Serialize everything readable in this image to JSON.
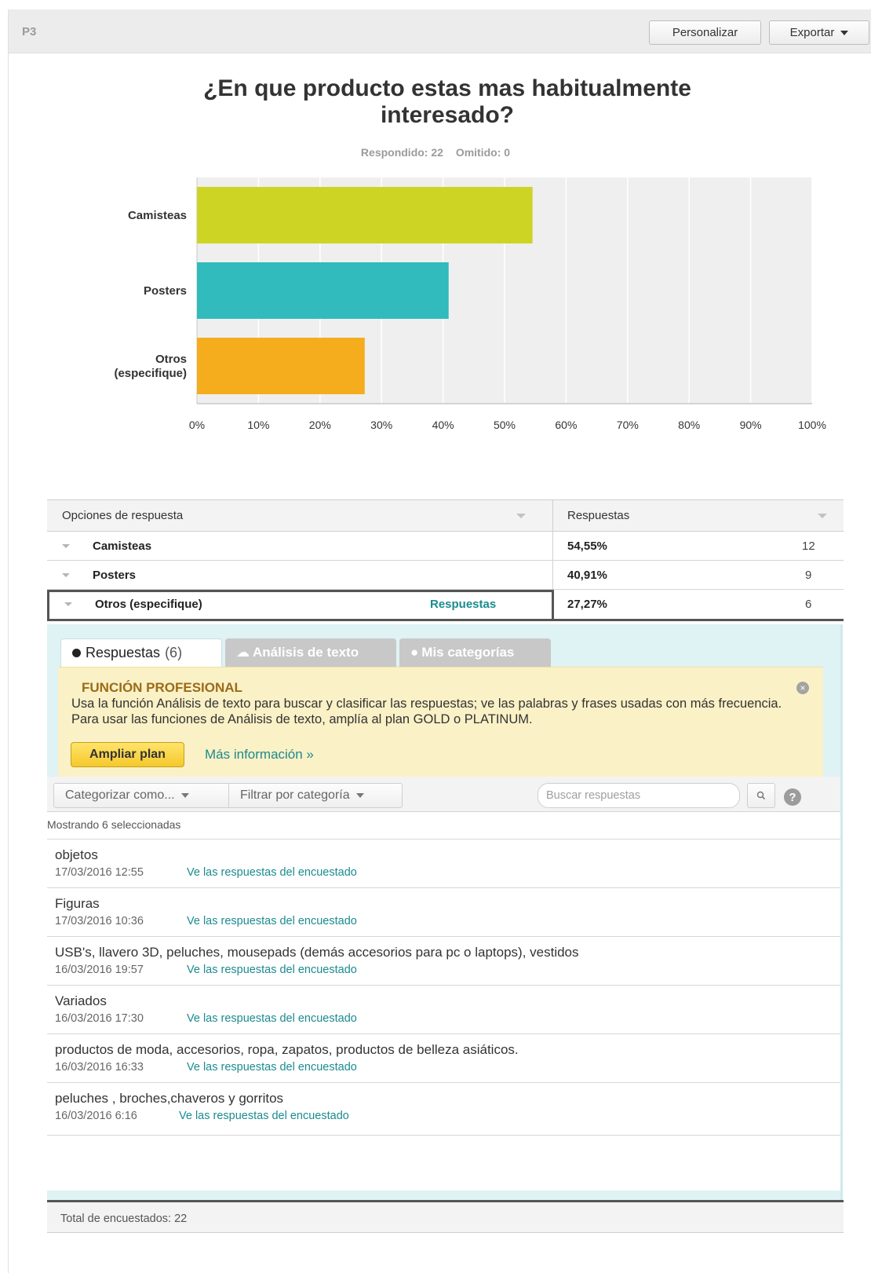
{
  "header": {
    "question_label": "P3",
    "personalize_label": "Personalizar",
    "export_label": "Exportar"
  },
  "question": {
    "title": "¿En que producto estas mas habitualmente interesado?",
    "answered": "Respondido: 22",
    "skipped": "Omitido: 0"
  },
  "colors": {
    "camisteas": "#cdd423",
    "posters": "#31bbbc",
    "otros": "#f5ad1d",
    "link": "#1b8b8e"
  },
  "chart_data": {
    "type": "bar",
    "orientation": "horizontal",
    "categories": [
      "Camisteas",
      "Posters",
      "Otros (especifique)"
    ],
    "values": [
      54.55,
      40.91,
      27.27
    ],
    "xlim": [
      0,
      100
    ],
    "x_ticks": [
      "0%",
      "10%",
      "20%",
      "30%",
      "40%",
      "50%",
      "60%",
      "70%",
      "80%",
      "90%",
      "100%"
    ],
    "grid": true
  },
  "table": {
    "col1_header": "Opciones de respuesta",
    "col2_header": "Respuestas",
    "rows": [
      {
        "label": "Camisteas",
        "pct": "54,55%",
        "count": "12"
      },
      {
        "label": "Posters",
        "pct": "40,91%",
        "count": "9"
      },
      {
        "label": "Otros (especifique)",
        "pct": "27,27%",
        "count": "6",
        "link": "Respuestas"
      }
    ],
    "total": "Total de encuestados: 22"
  },
  "tabs": {
    "responses_label": "Respuestas",
    "responses_count": "(6)",
    "text_analysis_label": "Análisis de texto",
    "categories_label": "Mis categorías"
  },
  "promo": {
    "title": "FUNCIÓN PROFESIONAL",
    "text": "Usa la función Análisis de texto para buscar y clasificar las respuestas; ve las palabras y frases usadas con más frecuencia. Para usar las funciones de Análisis de texto, amplía al plan GOLD o PLATINUM.",
    "upgrade_label": "Ampliar plan",
    "more_label": "Más información »"
  },
  "toolbar": {
    "categorize_label": "Categorizar como...",
    "filter_label": "Filtrar por categoría",
    "search_placeholder": "Buscar respuestas"
  },
  "responses": {
    "showing": "Mostrando 6 seleccionadas",
    "link_label": "Ve las respuestas del encuestado",
    "items": [
      {
        "text": "objetos",
        "date": "17/03/2016 12:55"
      },
      {
        "text": "Figuras",
        "date": "17/03/2016 10:36"
      },
      {
        "text": "USB's, llavero 3D, peluches, mousepads (demás accesorios para pc o laptops), vestidos",
        "date": "16/03/2016 19:57"
      },
      {
        "text": "Variados",
        "date": "16/03/2016 17:30"
      },
      {
        "text": "productos de moda, accesorios, ropa, zapatos, productos de belleza asiáticos.",
        "date": "16/03/2016 16:33"
      },
      {
        "text": "peluches , broches,chaveros y gorritos",
        "date": "16/03/2016 6:16"
      }
    ]
  }
}
